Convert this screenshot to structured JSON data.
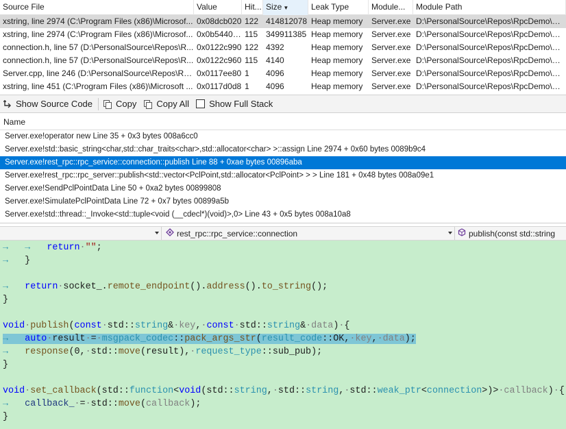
{
  "leaks": {
    "columns": [
      "Source File",
      "Value",
      "Hit...",
      "Size",
      "Leak Type",
      "Module...",
      "Module Path"
    ],
    "sorted_column": "Size",
    "rows": [
      [
        "xstring, line 2974 (C:\\Program Files (x86)\\Microsof...",
        "0x08dcb020",
        "122",
        "414812078",
        "Heap memory",
        "Server.exe",
        "D:\\PersonalSource\\Repos\\RpcDemo\\Rele"
      ],
      [
        "xstring, line 2974 (C:\\Program Files (x86)\\Microsof...",
        "0x0b544020",
        "115",
        "349911385",
        "Heap memory",
        "Server.exe",
        "D:\\PersonalSource\\Repos\\RpcDemo\\Rele"
      ],
      [
        "connection.h, line 57 (D:\\PersonalSource\\Repos\\R...",
        "0x0122c990",
        "122",
        "4392",
        "Heap memory",
        "Server.exe",
        "D:\\PersonalSource\\Repos\\RpcDemo\\Rele"
      ],
      [
        "connection.h, line 57 (D:\\PersonalSource\\Repos\\R...",
        "0x0122c960",
        "115",
        "4140",
        "Heap memory",
        "Server.exe",
        "D:\\PersonalSource\\Repos\\RpcDemo\\Rele"
      ],
      [
        "Server.cpp, line 246 (D:\\PersonalSource\\Repos\\Rpc...",
        "0x0117ee80",
        "1",
        "4096",
        "Heap memory",
        "Server.exe",
        "D:\\PersonalSource\\Repos\\RpcDemo\\Rele"
      ],
      [
        "xstring, line 451 (C:\\Program Files (x86)\\Microsoft ...",
        "0x0117d0d8",
        "1",
        "4096",
        "Heap memory",
        "Server.exe",
        "D:\\PersonalSource\\Repos\\RpcDemo\\Rele"
      ]
    ]
  },
  "toolbar": {
    "show_source": "Show Source Code",
    "copy": "Copy",
    "copy_all": "Copy All",
    "show_full_stack": "Show Full Stack"
  },
  "stack": {
    "header": "Name",
    "frames": [
      "Server.exe!operator new Line 35 + 0x3 bytes 008a6cc0",
      "Server.exe!std::basic_string<char,std::char_traits<char>,std::allocator<char> >::assign Line 2974 + 0x60 bytes 0089b9c4",
      "Server.exe!rest_rpc::rpc_service::connection::publish Line 88 + 0xae bytes 00896aba",
      "Server.exe!rest_rpc::rpc_server::publish<std::vector<PclPoint,std::allocator<PclPoint> > > Line 181 + 0x48 bytes 008a09e1",
      "Server.exe!SendPclPointData Line 50 + 0xa2 bytes 00899808",
      "Server.exe!SimulatePclPointData Line 72 + 0x7 bytes 00899a5b",
      "Server.exe!std::thread::_Invoke<std::tuple<void (__cdecl*)(void)>,0> Line 43 + 0x5 bytes 008a10a8"
    ],
    "selected_index": 2
  },
  "navbar": {
    "scope": "rest_rpc::rpc_service::connection",
    "member": "publish(const std::string"
  },
  "colors": {
    "editor_bg": "#c7edcc",
    "selection": "#0078d7",
    "highlight": "#7ec6d6"
  }
}
